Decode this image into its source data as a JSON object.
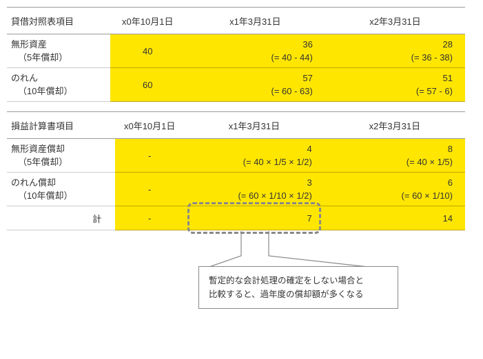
{
  "table1": {
    "header": {
      "label": "貸借対照表項目",
      "c0": "x0年10月1日",
      "c1": "x1年3月31日",
      "c2": "x2年3月31日"
    },
    "rows": [
      {
        "label_main": "無形資産",
        "label_sub": "（5年償却）",
        "v0": "40",
        "v1_val": "36",
        "v1_formula": "(= 40 - 44)",
        "v2_val": "28",
        "v2_formula": "(= 36 - 38)"
      },
      {
        "label_main": "のれん",
        "label_sub": "（10年償却）",
        "v0": "60",
        "v1_val": "57",
        "v1_formula": "(= 60 - 63)",
        "v2_val": "51",
        "v2_formula": "(= 57 - 6)"
      }
    ]
  },
  "table2": {
    "header": {
      "label": "損益計算書項目",
      "c0": "x0年10月1日",
      "c1": "x1年3月31日",
      "c2": "x2年3月31日"
    },
    "rows": [
      {
        "label_main": "無形資産償却",
        "label_sub": "（5年償却）",
        "v0": "-",
        "v1_val": "4",
        "v1_formula": "(= 40 × 1/5 × 1/2)",
        "v2_val": "8",
        "v2_formula": "(= 40 × 1/5)"
      },
      {
        "label_main": "のれん償却",
        "label_sub": "（10年償却）",
        "v0": "-",
        "v1_val": "3",
        "v1_formula": "(= 60 × 1/10 × 1/2)",
        "v2_val": "6",
        "v2_formula": "(= 60 × 1/10)"
      }
    ],
    "total": {
      "label": "計",
      "v0": "-",
      "v1": "7",
      "v2": "14"
    }
  },
  "callout": {
    "line1": "暫定的な会計処理の確定をしない場合と",
    "line2": "比較すると、過年度の償却額が多くなる"
  },
  "chart_data": {
    "type": "table",
    "tables": [
      {
        "title": "貸借対照表項目",
        "columns": [
          "x0年10月1日",
          "x1年3月31日",
          "x2年3月31日"
        ],
        "rows": [
          {
            "item": "無形資産 (5年償却)",
            "values": [
              40,
              36,
              28
            ],
            "formulas": [
              "",
              "= 40 - 44",
              "= 36 - 38"
            ]
          },
          {
            "item": "のれん (10年償却)",
            "values": [
              60,
              57,
              51
            ],
            "formulas": [
              "",
              "= 60 - 63",
              "= 57 - 6"
            ]
          }
        ]
      },
      {
        "title": "損益計算書項目",
        "columns": [
          "x0年10月1日",
          "x1年3月31日",
          "x2年3月31日"
        ],
        "rows": [
          {
            "item": "無形資産償却 (5年償却)",
            "values": [
              null,
              4,
              8
            ],
            "formulas": [
              "",
              "= 40 × 1/5 × 1/2",
              "= 40 × 1/5"
            ]
          },
          {
            "item": "のれん償却 (10年償却)",
            "values": [
              null,
              3,
              6
            ],
            "formulas": [
              "",
              "= 60 × 1/10 × 1/2",
              "= 60 × 1/10"
            ]
          }
        ],
        "total": {
          "label": "計",
          "values": [
            null,
            7,
            14
          ]
        }
      }
    ],
    "annotation": "暫定的な会計処理の確定をしない場合と比較すると、過年度の償却額が多くなる"
  }
}
